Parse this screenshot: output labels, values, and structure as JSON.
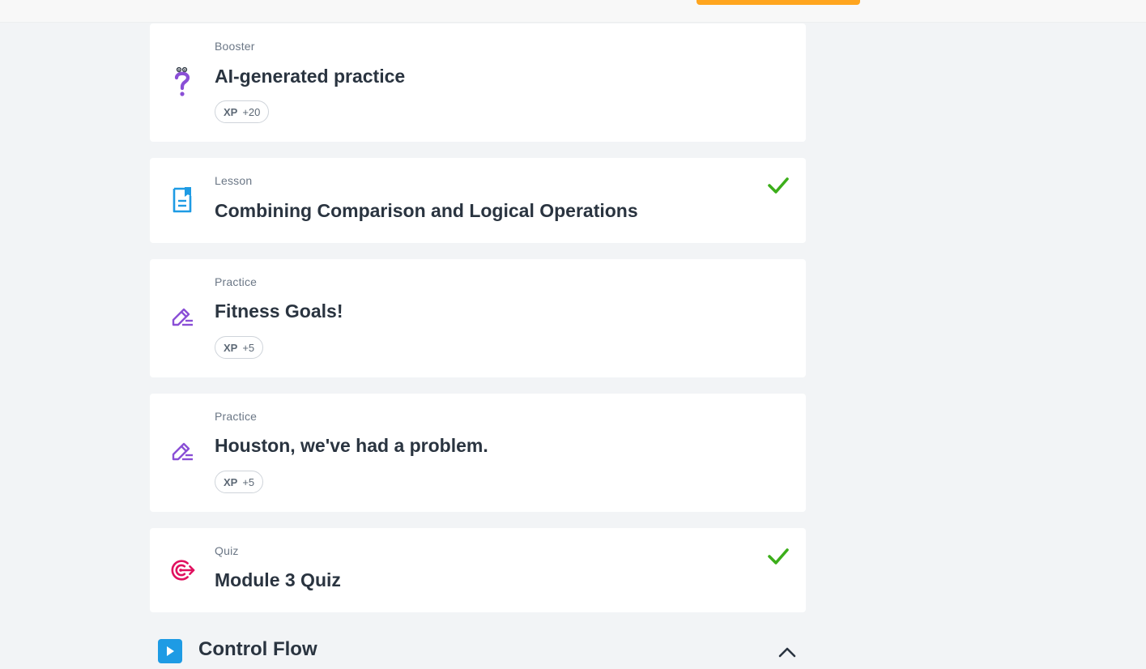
{
  "colors": {
    "booster": "#8a4fd6",
    "lesson": "#1e9be4",
    "practice": "#8a4fd6",
    "quiz": "#e0115f",
    "check": "#3cae1a",
    "cta": "#ffa51f"
  },
  "items": [
    {
      "kind": "Booster",
      "title": "AI-generated practice",
      "icon": "question-mark-icon",
      "xp_label": "XP",
      "xp_value": "+20",
      "completed": false
    },
    {
      "kind": "Lesson",
      "title": "Combining Comparison and Logical Operations",
      "icon": "lesson-document-icon",
      "completed": true
    },
    {
      "kind": "Practice",
      "title": "Fitness Goals!",
      "icon": "pencil-edit-icon",
      "xp_label": "XP",
      "xp_value": "+5",
      "completed": false
    },
    {
      "kind": "Practice",
      "title": "Houston, we've had a problem.",
      "icon": "pencil-edit-icon",
      "xp_label": "XP",
      "xp_value": "+5",
      "completed": false
    },
    {
      "kind": "Quiz",
      "title": "Module 3 Quiz",
      "icon": "target-icon",
      "completed": true
    }
  ],
  "section": {
    "title": "Control Flow",
    "icon": "play-icon",
    "expanded": true
  }
}
